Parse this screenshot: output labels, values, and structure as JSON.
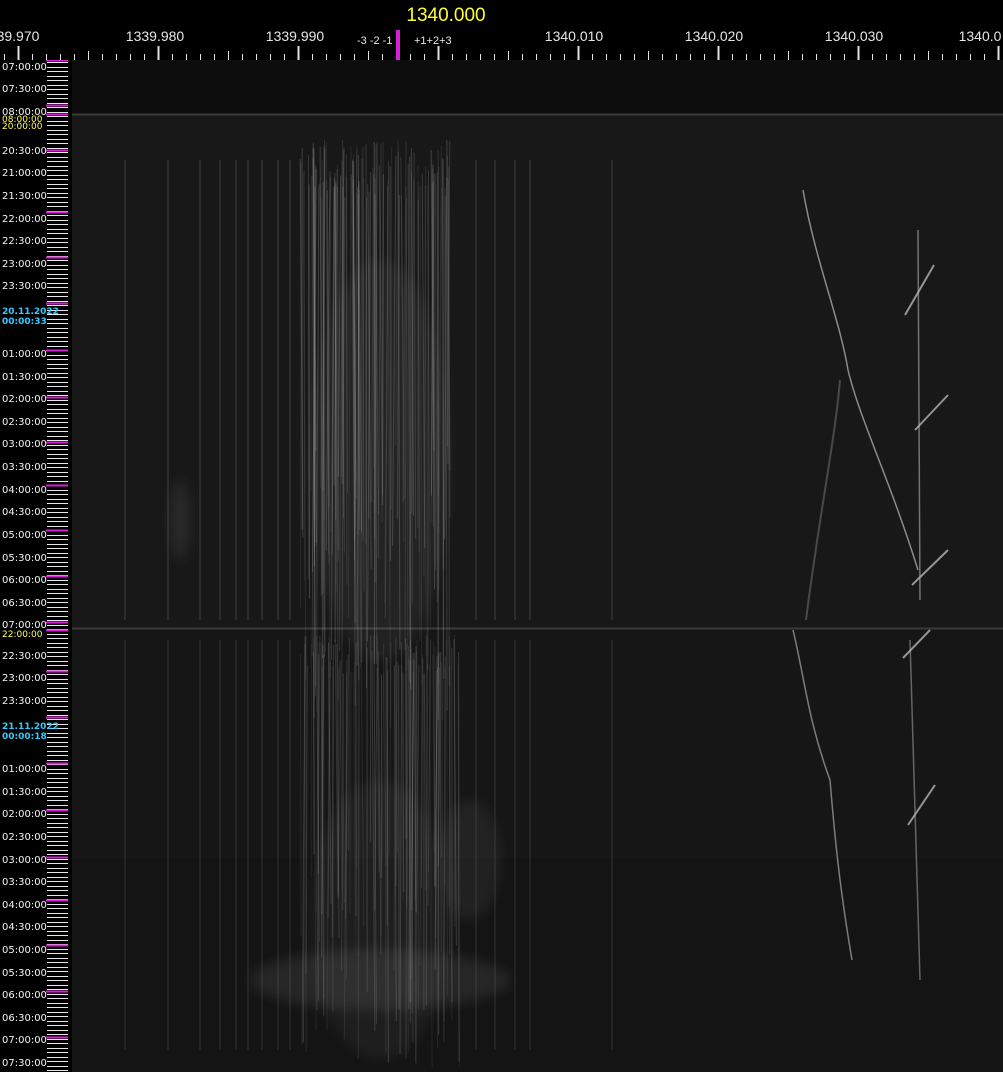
{
  "spectrogram": {
    "center_frequency": "1340.000",
    "frequency_labels": [
      "39.970",
      "1339.980",
      "1339.990",
      "1340.010",
      "1340.020",
      "1340.030",
      "1340.0"
    ],
    "offset_labels": {
      "left": "-3 -2 -1",
      "right": "+1+2+3"
    },
    "colors": {
      "center_frequency": "#ffff33",
      "tuning_marker": "#d71fd7",
      "date_label": "#33ccff",
      "segment_start_label": "#ffff55",
      "grid_tick": "#ffffff",
      "major_tick": "#d71fd7"
    }
  },
  "time_axis": {
    "segment_1": [
      "07:00:00",
      "07:30:00",
      "08:00:00"
    ],
    "segment_2_start": [
      "08:00:00",
      "20:00:00"
    ],
    "segment_2": [
      "20:30:00",
      "21:00:00",
      "21:30:00",
      "22:00:00",
      "22:30:00",
      "23:00:00",
      "23:30:00"
    ],
    "date_1": {
      "date": "20.11.2022",
      "time": "00:00:33"
    },
    "segment_2b": [
      "01:00:00",
      "01:30:00",
      "02:00:00",
      "02:30:00",
      "03:00:00",
      "03:30:00",
      "04:00:00",
      "04:30:00",
      "05:00:00",
      "05:30:00",
      "06:00:00",
      "06:30:00",
      "07:00:00"
    ],
    "segment_3_start": "22:00:00",
    "segment_3": [
      "22:30:00",
      "23:00:00",
      "23:30:00"
    ],
    "date_2": {
      "date": "21.11.2022",
      "time": "00:00:18"
    },
    "segment_3b": [
      "01:00:00",
      "01:30:00",
      "02:00:00",
      "02:30:00",
      "03:00:00",
      "03:30:00",
      "04:00:00",
      "04:30:00",
      "05:00:00",
      "05:30:00",
      "06:00:00",
      "06:30:00",
      "07:00:00",
      "07:30:00"
    ]
  }
}
